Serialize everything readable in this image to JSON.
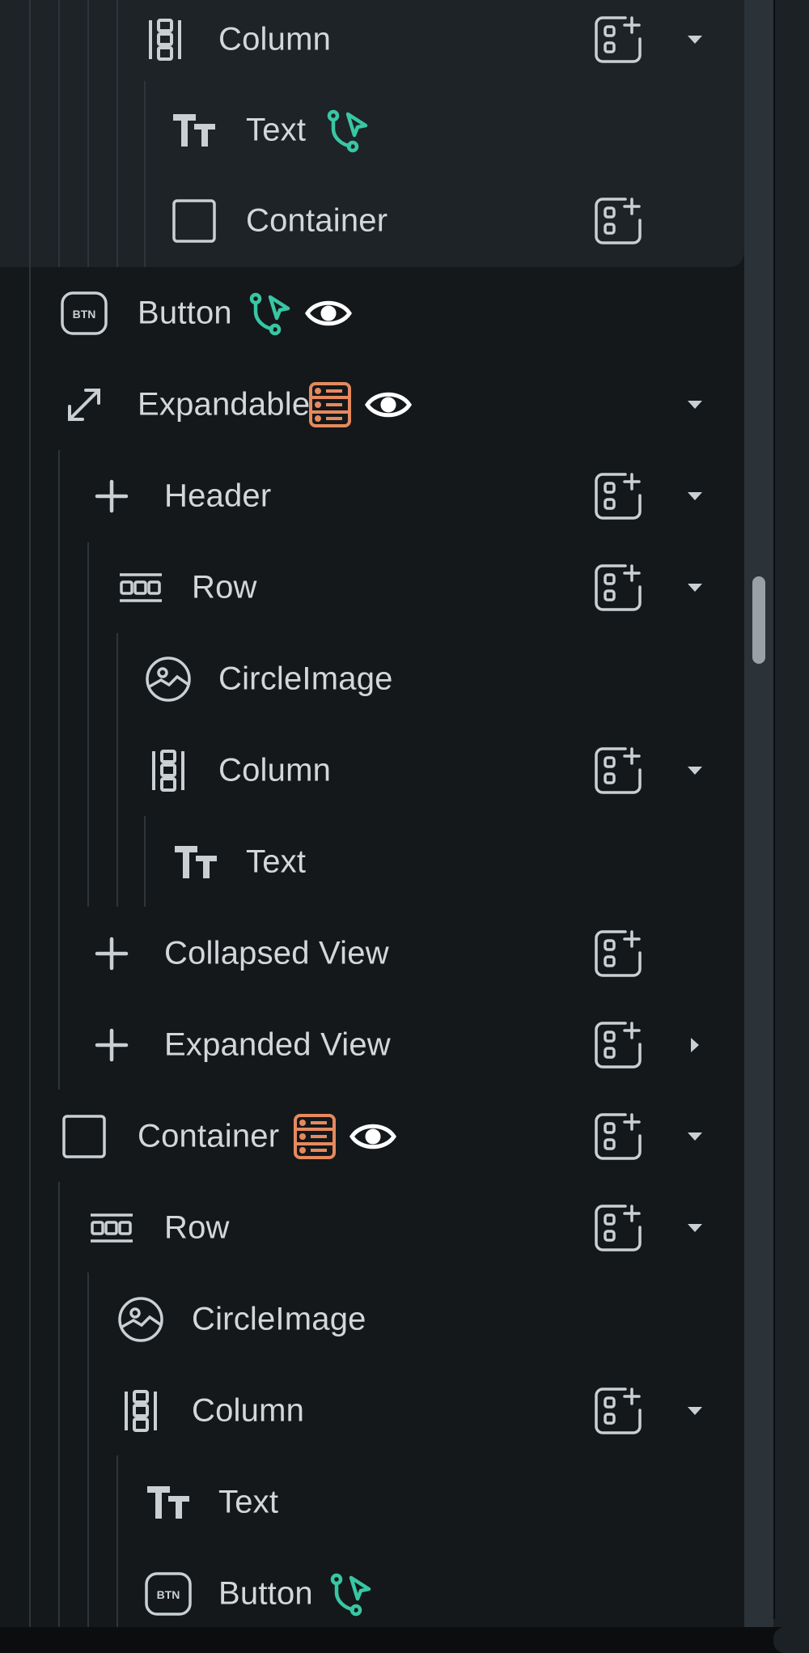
{
  "tree": {
    "items": [
      {
        "label": "Column",
        "icon": "column-icon",
        "badges": [],
        "add": true,
        "caret": "down"
      },
      {
        "label": "Text",
        "icon": "text-icon",
        "badges": [
          "action-flow-icon"
        ],
        "add": false,
        "caret": null
      },
      {
        "label": "Container",
        "icon": "container-icon",
        "badges": [],
        "add": true,
        "caret": null
      },
      {
        "label": "Button",
        "icon": "button-icon",
        "badges": [
          "action-flow-icon",
          "eye-icon"
        ],
        "add": false,
        "caret": null
      },
      {
        "label": "Expandable",
        "icon": "expand-icon",
        "badges": [
          "database-icon",
          "eye-icon"
        ],
        "add": false,
        "caret": "down"
      },
      {
        "label": "Header",
        "icon": "plus-icon",
        "badges": [],
        "add": true,
        "caret": "down"
      },
      {
        "label": "Row",
        "icon": "row-icon",
        "badges": [],
        "add": true,
        "caret": "down"
      },
      {
        "label": "CircleImage",
        "icon": "circle-image-icon",
        "badges": [],
        "add": false,
        "caret": null
      },
      {
        "label": "Column",
        "icon": "column-icon",
        "badges": [],
        "add": true,
        "caret": "down"
      },
      {
        "label": "Text",
        "icon": "text-icon",
        "badges": [],
        "add": false,
        "caret": null
      },
      {
        "label": "Collapsed View",
        "icon": "plus-icon",
        "badges": [],
        "add": true,
        "caret": null
      },
      {
        "label": "Expanded View",
        "icon": "plus-icon",
        "badges": [],
        "add": true,
        "caret": "right"
      },
      {
        "label": "Container",
        "icon": "container-icon",
        "badges": [
          "database-icon",
          "eye-icon"
        ],
        "add": true,
        "caret": "down"
      },
      {
        "label": "Row",
        "icon": "row-icon",
        "badges": [],
        "add": true,
        "caret": "down"
      },
      {
        "label": "CircleImage",
        "icon": "circle-image-icon",
        "badges": [],
        "add": false,
        "caret": null
      },
      {
        "label": "Column",
        "icon": "column-icon",
        "badges": [],
        "add": true,
        "caret": "down"
      },
      {
        "label": "Text",
        "icon": "text-icon",
        "badges": [],
        "add": false,
        "caret": null
      },
      {
        "label": "Button",
        "icon": "button-icon",
        "badges": [
          "action-flow-icon"
        ],
        "add": false,
        "caret": null
      }
    ]
  },
  "icon_text": {
    "button": "BTN"
  },
  "colors": {
    "background": "#14181b",
    "selected_block": "#1d2327",
    "text": "#d3d7da",
    "icon": "#c9cfd3",
    "action_flow": "#39c6a3",
    "database": "#e58a5e",
    "eye": "#ffffff",
    "scrollbar_thumb": "#9aa1a6"
  }
}
